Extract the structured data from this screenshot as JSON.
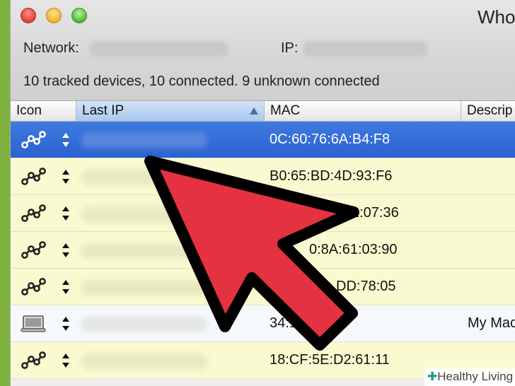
{
  "window": {
    "title": "Who"
  },
  "network": {
    "network_label": "Network:",
    "ip_label": "IP:"
  },
  "summary": "10 tracked devices, 10 connected. 9 unknown connected",
  "columns": [
    {
      "label": "Icon"
    },
    {
      "label": "Last IP",
      "sorted": "ascending"
    },
    {
      "label": "MAC"
    },
    {
      "label": "Descrip"
    }
  ],
  "rows": [
    {
      "icon": "network-link-icon",
      "mac": "0C:60:76:6A:B4:F8",
      "description": "",
      "selected": true
    },
    {
      "icon": "network-link-icon",
      "mac": "B0:65:BD:4D:93:F6",
      "description": ""
    },
    {
      "icon": "network-link-icon",
      "mac": "1:07:36",
      "description": ""
    },
    {
      "icon": "network-link-icon",
      "mac": "0:8A:61:03:90",
      "description": ""
    },
    {
      "icon": "network-link-icon",
      "mac": "DD:78:05",
      "description": ""
    },
    {
      "icon": "laptop-icon",
      "mac": "34:15:9A:98",
      "description": "My Mac"
    },
    {
      "icon": "network-link-icon",
      "mac": "18:CF:5E:D2:61:11",
      "description": ""
    }
  ],
  "watermark": "Healthy Living",
  "colors": {
    "selected_row": "#2f6bd6",
    "device_row": "#fafad0",
    "annotation_arrow": "#e53241"
  }
}
